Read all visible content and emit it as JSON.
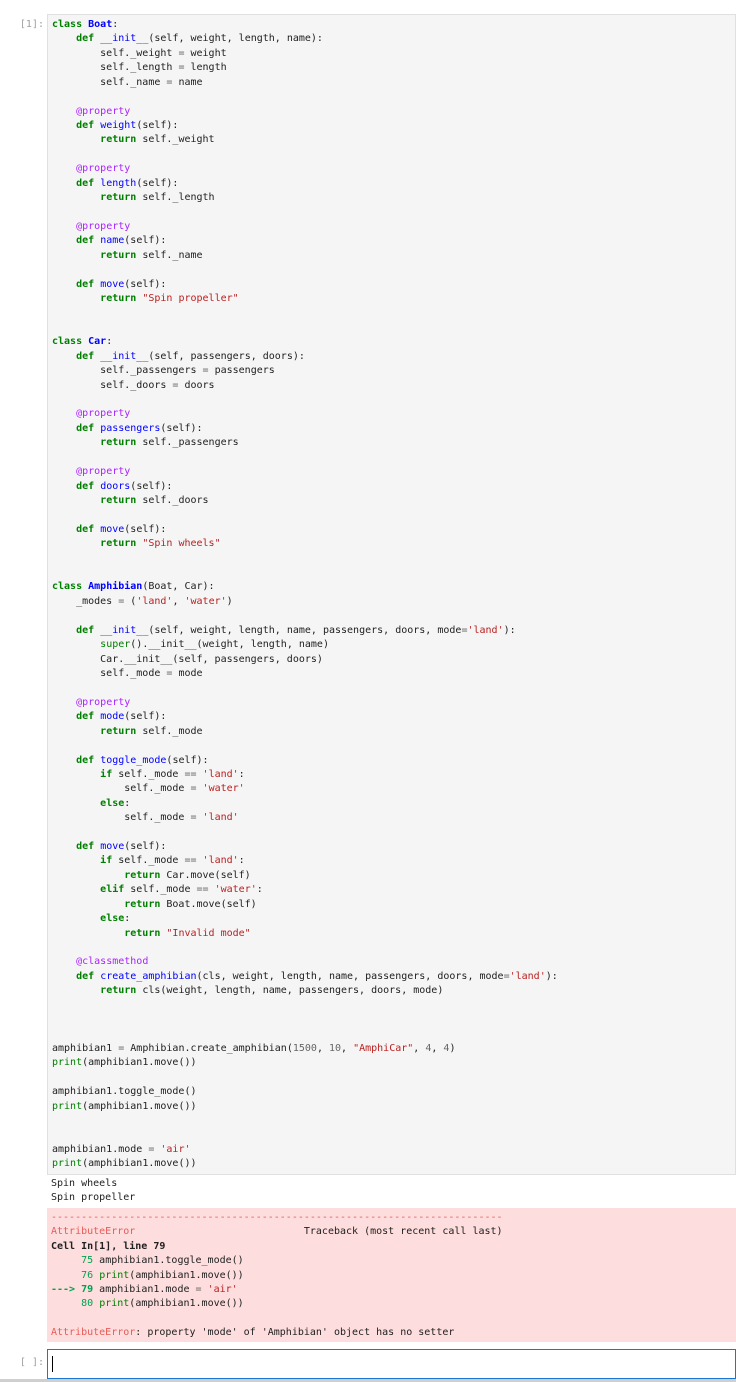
{
  "cells": [
    {
      "prompt": "[1]:",
      "code_lines": [
        "class Boat:",
        "    def __init__(self, weight, length, name):",
        "        self._weight = weight",
        "        self._length = length",
        "        self._name = name",
        "",
        "    @property",
        "    def weight(self):",
        "        return self._weight",
        "",
        "    @property",
        "    def length(self):",
        "        return self._length",
        "",
        "    @property",
        "    def name(self):",
        "        return self._name",
        "",
        "    def move(self):",
        "        return \"Spin propeller\"",
        "",
        "",
        "class Car:",
        "    def __init__(self, passengers, doors):",
        "        self._passengers = passengers",
        "        self._doors = doors",
        "",
        "    @property",
        "    def passengers(self):",
        "        return self._passengers",
        "",
        "    @property",
        "    def doors(self):",
        "        return self._doors",
        "",
        "    def move(self):",
        "        return \"Spin wheels\"",
        "",
        "",
        "class Amphibian(Boat, Car):",
        "    _modes = ('land', 'water')",
        "",
        "    def __init__(self, weight, length, name, passengers, doors, mode='land'):",
        "        super().__init__(weight, length, name)",
        "        Car.__init__(self, passengers, doors)",
        "        self._mode = mode",
        "",
        "    @property",
        "    def mode(self):",
        "        return self._mode",
        "",
        "    def toggle_mode(self):",
        "        if self._mode == 'land':",
        "            self._mode = 'water'",
        "        else:",
        "            self._mode = 'land'",
        "",
        "    def move(self):",
        "        if self._mode == 'land':",
        "            return Car.move(self)",
        "        elif self._mode == 'water':",
        "            return Boat.move(self)",
        "        else:",
        "            return \"Invalid mode\"",
        "",
        "    @classmethod",
        "    def create_amphibian(cls, weight, length, name, passengers, doors, mode='land'):",
        "        return cls(weight, length, name, passengers, doors, mode)",
        "",
        "",
        "",
        "amphibian1 = Amphibian.create_amphibian(1500, 10, \"AmphiCar\", 4, 4)",
        "print(amphibian1.move())",
        "",
        "amphibian1.toggle_mode()",
        "print(amphibian1.move())",
        "",
        "",
        "amphibian1.mode = 'air'",
        "print(amphibian1.move())"
      ],
      "stdout": "Spin wheels\nSpin propeller",
      "error": {
        "separator": "---------------------------------------------------------------------------",
        "ename": "AttributeError",
        "traceback_header": "Traceback (most recent call last)",
        "cell_ref": "Cell In[1], line 79",
        "tb_lines": [
          {
            "marker": "     ",
            "num": "75",
            "code": "amphibian1.toggle_mode()"
          },
          {
            "marker": "     ",
            "num": "76",
            "code": "print(amphibian1.move())"
          },
          {
            "marker": "---> ",
            "num": "79",
            "code": "amphibian1.mode = 'air'"
          },
          {
            "marker": "     ",
            "num": "80",
            "code": "print(amphibian1.move())"
          }
        ],
        "evalue": ": property 'mode' of 'Amphibian' object has no setter"
      }
    },
    {
      "prompt": "[ ]:",
      "code_lines": []
    }
  ]
}
